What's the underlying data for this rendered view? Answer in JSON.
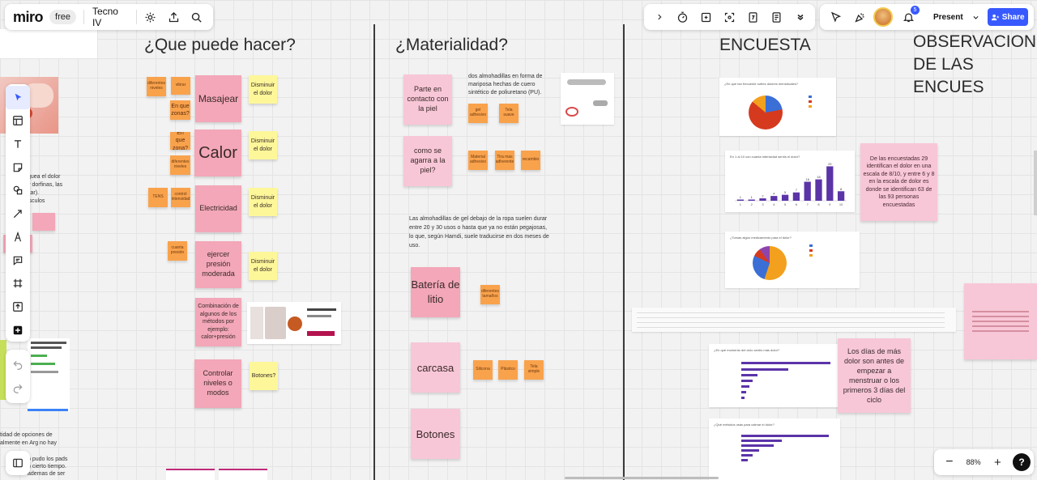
{
  "topbar": {
    "logo": "miro",
    "plan_badge": "free",
    "board_name": "Tecno IV",
    "right_tools": [
      "chevron-right-icon",
      "timer-icon",
      "comment-frame-icon",
      "focus-icon",
      "count-icon",
      "notes-icon",
      "more-icon"
    ],
    "notif_count": "5",
    "present_label": "Present",
    "share_label": "Share"
  },
  "zoom": {
    "level": "88%",
    "minus": "−",
    "plus": "+",
    "help": "?"
  },
  "headings": {
    "que_puede": "¿Que puede hacer?",
    "materialidad": "¿Materialidad?",
    "encuesta": "ENCUESTA",
    "observaciones_1": "OBSERVACIONE",
    "observaciones_2": "DE LAS ENCUES"
  },
  "col1": {
    "masajear": "Masajear",
    "calor": "Calor",
    "electricidad": "Electricidad",
    "ejercer": "ejercer presión moderada",
    "combinacion": "Combinación de algunos de los métodos por ejemplo: calor+presión",
    "controlar": "Controlar niveles o modos",
    "disminuir_1": "Disminuir el dolor",
    "disminuir_2": "Disminuir el dolor",
    "disminuir_3": "Disminuir el dolor",
    "disminuir_4": "Disminuir el dolor",
    "botones_q": "Botones?",
    "en_que_zonas": "En que zonas?",
    "en_que_zona": "En que zona?",
    "o_diferentes": "diferentes niveles",
    "o_vibrar": "vibrar",
    "o_calor": "diferentes niveles",
    "o_tens": "TENS",
    "o_intensidad": "control intensidad",
    "o_cuanto": "cuanta presión"
  },
  "col2": {
    "parte_contacto": "Parte en contacto con la piel",
    "como_agarra": "como se agarra a la piel?",
    "bateria": "Batería de litio",
    "carcasa": "carcasa",
    "botones": "Botones",
    "desc_1": "dos almohadillas en forma de",
    "desc_2": "mariposa hechas de cuero",
    "desc_3": "sintético de poliuretano (PU).",
    "para_1": "Las almohadillas de gel debajo de la ropa suelen durar",
    "para_2": "entre 20 y 30 usos o hasta que ya no están pegajosas,",
    "para_3": "lo que, según Hamdi, suele traducirse en dos meses de",
    "para_4": "uso.",
    "o_pu": "gel adhesivo",
    "o_tela": "Tela suave",
    "o_material": "Material adhesivo",
    "o_tira": "Tira mas adherente",
    "o_recambio": "recambio",
    "o_bat": "diferentes tamaños",
    "o_silicona": "Silicona",
    "o_plastico": "Plástico",
    "o_tela2": "Tela simple"
  },
  "col3": {
    "encuestadas_note": "De las encuestadas 29 identifican el dolor en una escala de 8/10, y entre 6 y 8 en la escala de dolor es donde se identifican 63 de las 93 personas encuestadas",
    "dias_note": "Los días de más dolor son antes de empezar a menstruar o los primeros 3 días del ciclo",
    "chart1_title": "¿En que tan frecuente sufres dolores menstruales?",
    "chart2_title": "En 1 al 10 con cuanta intensidad sentís el dolor?",
    "chart3_title": "¿Tomas algún medicamento para el dolor?",
    "chart4_title": "¿En qué momento del ciclo sentís más dolor?",
    "chart5_title": "¿Qué métodos usás para calmar el dolor?"
  },
  "left_partial": {
    "lines": [
      "queа el dolor",
      "y dorfinas, las",
      "itar).",
      "isculos"
    ],
    "bottom_lines": [
      "tidad de opciones de",
      "almente en Arg no hay",
      "",
      "o pudo los pads",
      "n cierto tiempo.",
      "ademas de ser"
    ]
  },
  "chart_data": {
    "type": "bar",
    "title": "",
    "categories": [
      "1",
      "2",
      "3",
      "4",
      "5",
      "6",
      "7",
      "8",
      "9",
      "10"
    ],
    "values": [
      1,
      1,
      2,
      4,
      5,
      7,
      16,
      18,
      29,
      8
    ],
    "xlabel": "",
    "ylabel": "",
    "ylim": [
      0,
      30
    ]
  }
}
